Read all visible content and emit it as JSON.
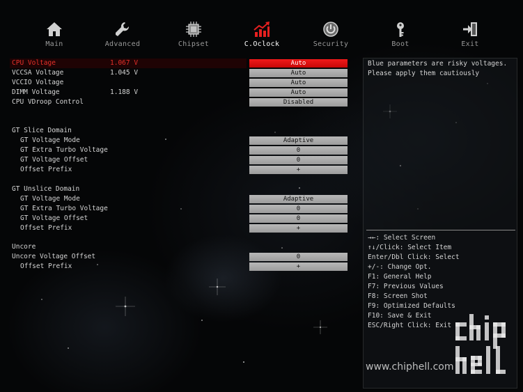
{
  "nav": [
    {
      "label": "Main",
      "icon": "home-icon"
    },
    {
      "label": "Advanced",
      "icon": "wrench-icon"
    },
    {
      "label": "Chipset",
      "icon": "chip-icon"
    },
    {
      "label": "C.Oclock",
      "icon": "oc-chart-icon",
      "active": true
    },
    {
      "label": "Security",
      "icon": "shield-icon"
    },
    {
      "label": "Boot",
      "icon": "key-icon"
    },
    {
      "label": "Exit",
      "icon": "exit-door-icon"
    }
  ],
  "settings": {
    "cpu_voltage": {
      "label": "CPU Voltage",
      "value": "1.067 V",
      "option": "Auto"
    },
    "vccsa_voltage": {
      "label": "VCCSA Voltage",
      "value": "1.045 V",
      "option": "Auto"
    },
    "vccio_voltage": {
      "label": "VCCIO Voltage",
      "option": "Auto"
    },
    "dimm_voltage": {
      "label": "DIMM Voltage",
      "value": "1.188 V",
      "option": "Auto"
    },
    "cpu_vdroop": {
      "label": "CPU VDroop Control",
      "option": "Disabled"
    },
    "gt_slice": {
      "heading": "GT Slice Domain",
      "mode": {
        "label": "GT Voltage Mode",
        "option": "Adaptive"
      },
      "extra_turbo": {
        "label": "GT Extra Turbo Voltage",
        "option": "0"
      },
      "offset": {
        "label": "GT Voltage Offset",
        "option": "0"
      },
      "prefix": {
        "label": "Offset Prefix",
        "option": "+"
      }
    },
    "gt_unslice": {
      "heading": "GT Unslice Domain",
      "mode": {
        "label": "GT Voltage Mode",
        "option": "Adaptive"
      },
      "extra_turbo": {
        "label": "GT Extra Turbo Voltage",
        "option": "0"
      },
      "offset": {
        "label": "GT Voltage Offset",
        "option": "0"
      },
      "prefix": {
        "label": "Offset Prefix",
        "option": "+"
      }
    },
    "uncore": {
      "heading": "Uncore",
      "offset": {
        "label": "Uncore Voltage Offset",
        "option": "0"
      },
      "prefix": {
        "label": "Offset Prefix",
        "option": "+"
      }
    }
  },
  "help": {
    "description": "Blue parameters are risky voltages. Please apply them cautiously",
    "keys": [
      "→←: Select Screen",
      "↑↓/Click: Select Item",
      "Enter/Dbl Click: Select",
      "+/-: Change Opt.",
      "F1: General Help",
      "F7: Previous Values",
      "F8: Screen Shot",
      "F9: Optimized Defaults",
      "F10: Save & Exit",
      "ESC/Right Click: Exit"
    ]
  },
  "watermark": {
    "logo_text": "chiphell",
    "url": "www.chiphell.com"
  },
  "colors": {
    "selected": "#e8302a",
    "option_bg": "#a8a8a8",
    "nav_active_icon": "#e62020"
  }
}
